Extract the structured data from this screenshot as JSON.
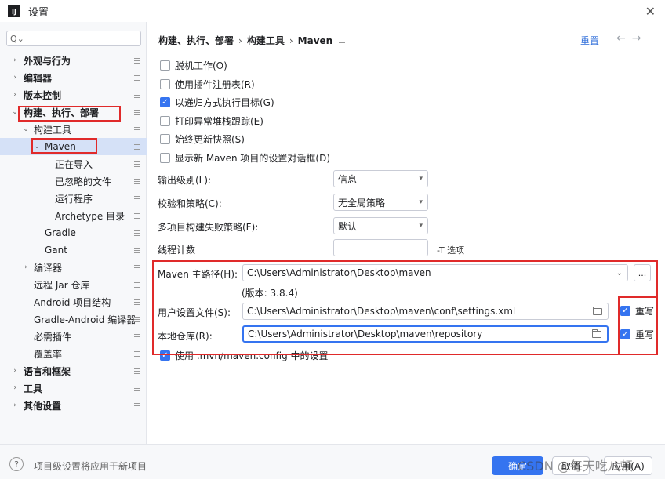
{
  "window": {
    "title": "设置"
  },
  "search": {
    "placeholder": ""
  },
  "tree": [
    {
      "label": "外观与行为"
    },
    {
      "label": "编辑器"
    },
    {
      "label": "版本控制"
    },
    {
      "label": "构建、执行、部署"
    },
    {
      "label": "构建工具"
    },
    {
      "label": "Maven"
    },
    {
      "label": "正在导入"
    },
    {
      "label": "已忽略的文件"
    },
    {
      "label": "运行程序"
    },
    {
      "label": "Archetype 目录"
    },
    {
      "label": "Gradle"
    },
    {
      "label": "Gant"
    },
    {
      "label": "编译器"
    },
    {
      "label": "远程 Jar 仓库"
    },
    {
      "label": "Android 项目结构"
    },
    {
      "label": "Gradle-Android 编译器"
    },
    {
      "label": "必需插件"
    },
    {
      "label": "覆盖率"
    },
    {
      "label": "语言和框架"
    },
    {
      "label": "工具"
    },
    {
      "label": "其他设置"
    }
  ],
  "breadcrumb": {
    "part1": "构建、执行、部署",
    "part2": "构建工具",
    "part3": "Maven"
  },
  "reset_label": "重置",
  "checkboxes": [
    {
      "label": "脱机工作(O)",
      "checked": false
    },
    {
      "label": "使用插件注册表(R)",
      "checked": false
    },
    {
      "label": "以递归方式执行目标(G)",
      "checked": true
    },
    {
      "label": "打印异常堆栈跟踪(E)",
      "checked": false
    },
    {
      "label": "始终更新快照(S)",
      "checked": false
    },
    {
      "label": "显示新 Maven 项目的设置对话框(D)",
      "checked": false
    }
  ],
  "output_level": {
    "label": "输出级别(L):",
    "value": "信息"
  },
  "checksum_policy": {
    "label": "校验和策略(C):",
    "value": "无全局策略"
  },
  "multiproject_fail": {
    "label": "多项目构建失败策略(F):",
    "value": "默认"
  },
  "thread_count": {
    "label": "线程计数",
    "value": "",
    "hint": "-T 选项"
  },
  "maven_home": {
    "label": "Maven 主路径(H):",
    "value": "C:\\Users\\Administrator\\Desktop\\maven",
    "browse": "...",
    "version": "(版本: 3.8.4)"
  },
  "user_settings": {
    "label": "用户设置文件(S):",
    "value": "C:\\Users\\Administrator\\Desktop\\maven\\conf\\settings.xml",
    "override_label": "重写",
    "override": true
  },
  "local_repo": {
    "label": "本地仓库(R):",
    "value": "C:\\Users\\Administrator\\Desktop\\maven\\repository",
    "override_label": "重写",
    "override": true
  },
  "use_mvn_config": {
    "label": "使用 .mvn/maven.config 中的设置",
    "checked": true
  },
  "footer": {
    "note": "项目级设置将应用于新项目",
    "ok": "确定",
    "cancel": "取消",
    "apply": "应用(A)"
  },
  "watermark": "CSDN @每天吃八顿"
}
